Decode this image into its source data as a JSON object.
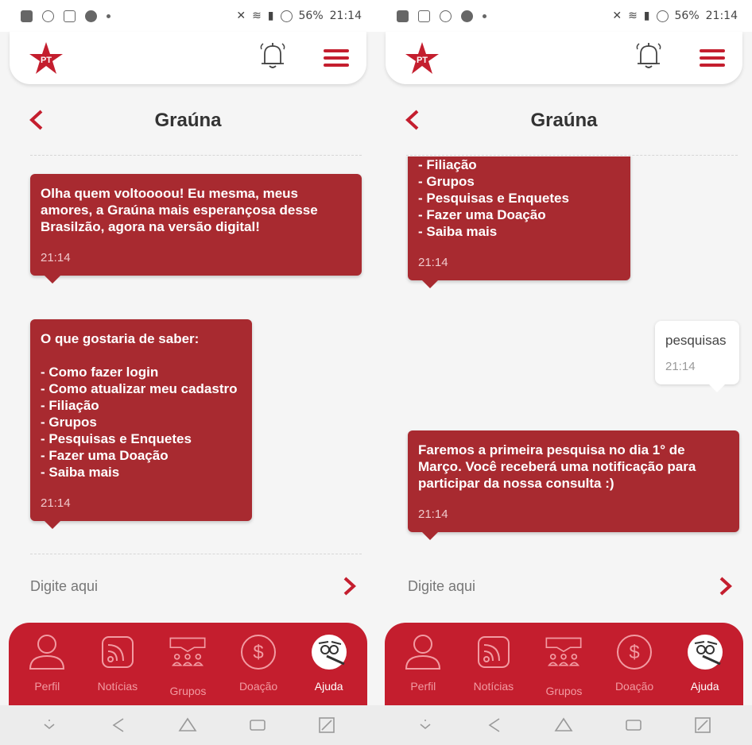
{
  "status_bar": {
    "battery": "56%",
    "time": "21:14"
  },
  "brand": {
    "logo_text": "PT",
    "accent": "#c41e2e",
    "bubble": "#a82a30"
  },
  "chat_title": "Graúna",
  "input_placeholder": "Digite aqui",
  "nav": [
    {
      "label": "Perfil",
      "icon": "user-icon"
    },
    {
      "label": "Notícias",
      "icon": "rss-icon"
    },
    {
      "label": "Grupos",
      "icon": "groups-icon"
    },
    {
      "label": "Doação",
      "icon": "donation-icon"
    },
    {
      "label": "Ajuda",
      "icon": "help-bird-icon"
    }
  ],
  "screens": [
    {
      "messages": [
        {
          "from": "bot",
          "text": "Olha quem voltoooou! Eu mesma, meus amores, a Graúna mais esperançosa desse Brasilzão, agora na versão digital!",
          "time": "21:14"
        },
        {
          "from": "bot",
          "text": "O que gostaria de saber:\n\n- Como fazer login\n- Como atualizar meu cadastro\n- Filiação\n- Grupos\n- Pesquisas e Enquetes\n- Fazer uma Doação\n- Saiba mais",
          "time": "21:14"
        }
      ]
    },
    {
      "messages": [
        {
          "from": "bot",
          "text": "- Filiação\n- Grupos\n- Pesquisas e Enquetes\n- Fazer uma Doação\n- Saiba mais",
          "time": "21:14"
        },
        {
          "from": "user",
          "text": "pesquisas",
          "time": "21:14"
        },
        {
          "from": "bot",
          "text": "Faremos a primeira pesquisa no dia 1° de Março. Você receberá uma notificação para participar da nossa consulta :)",
          "time": "21:14"
        }
      ]
    }
  ]
}
